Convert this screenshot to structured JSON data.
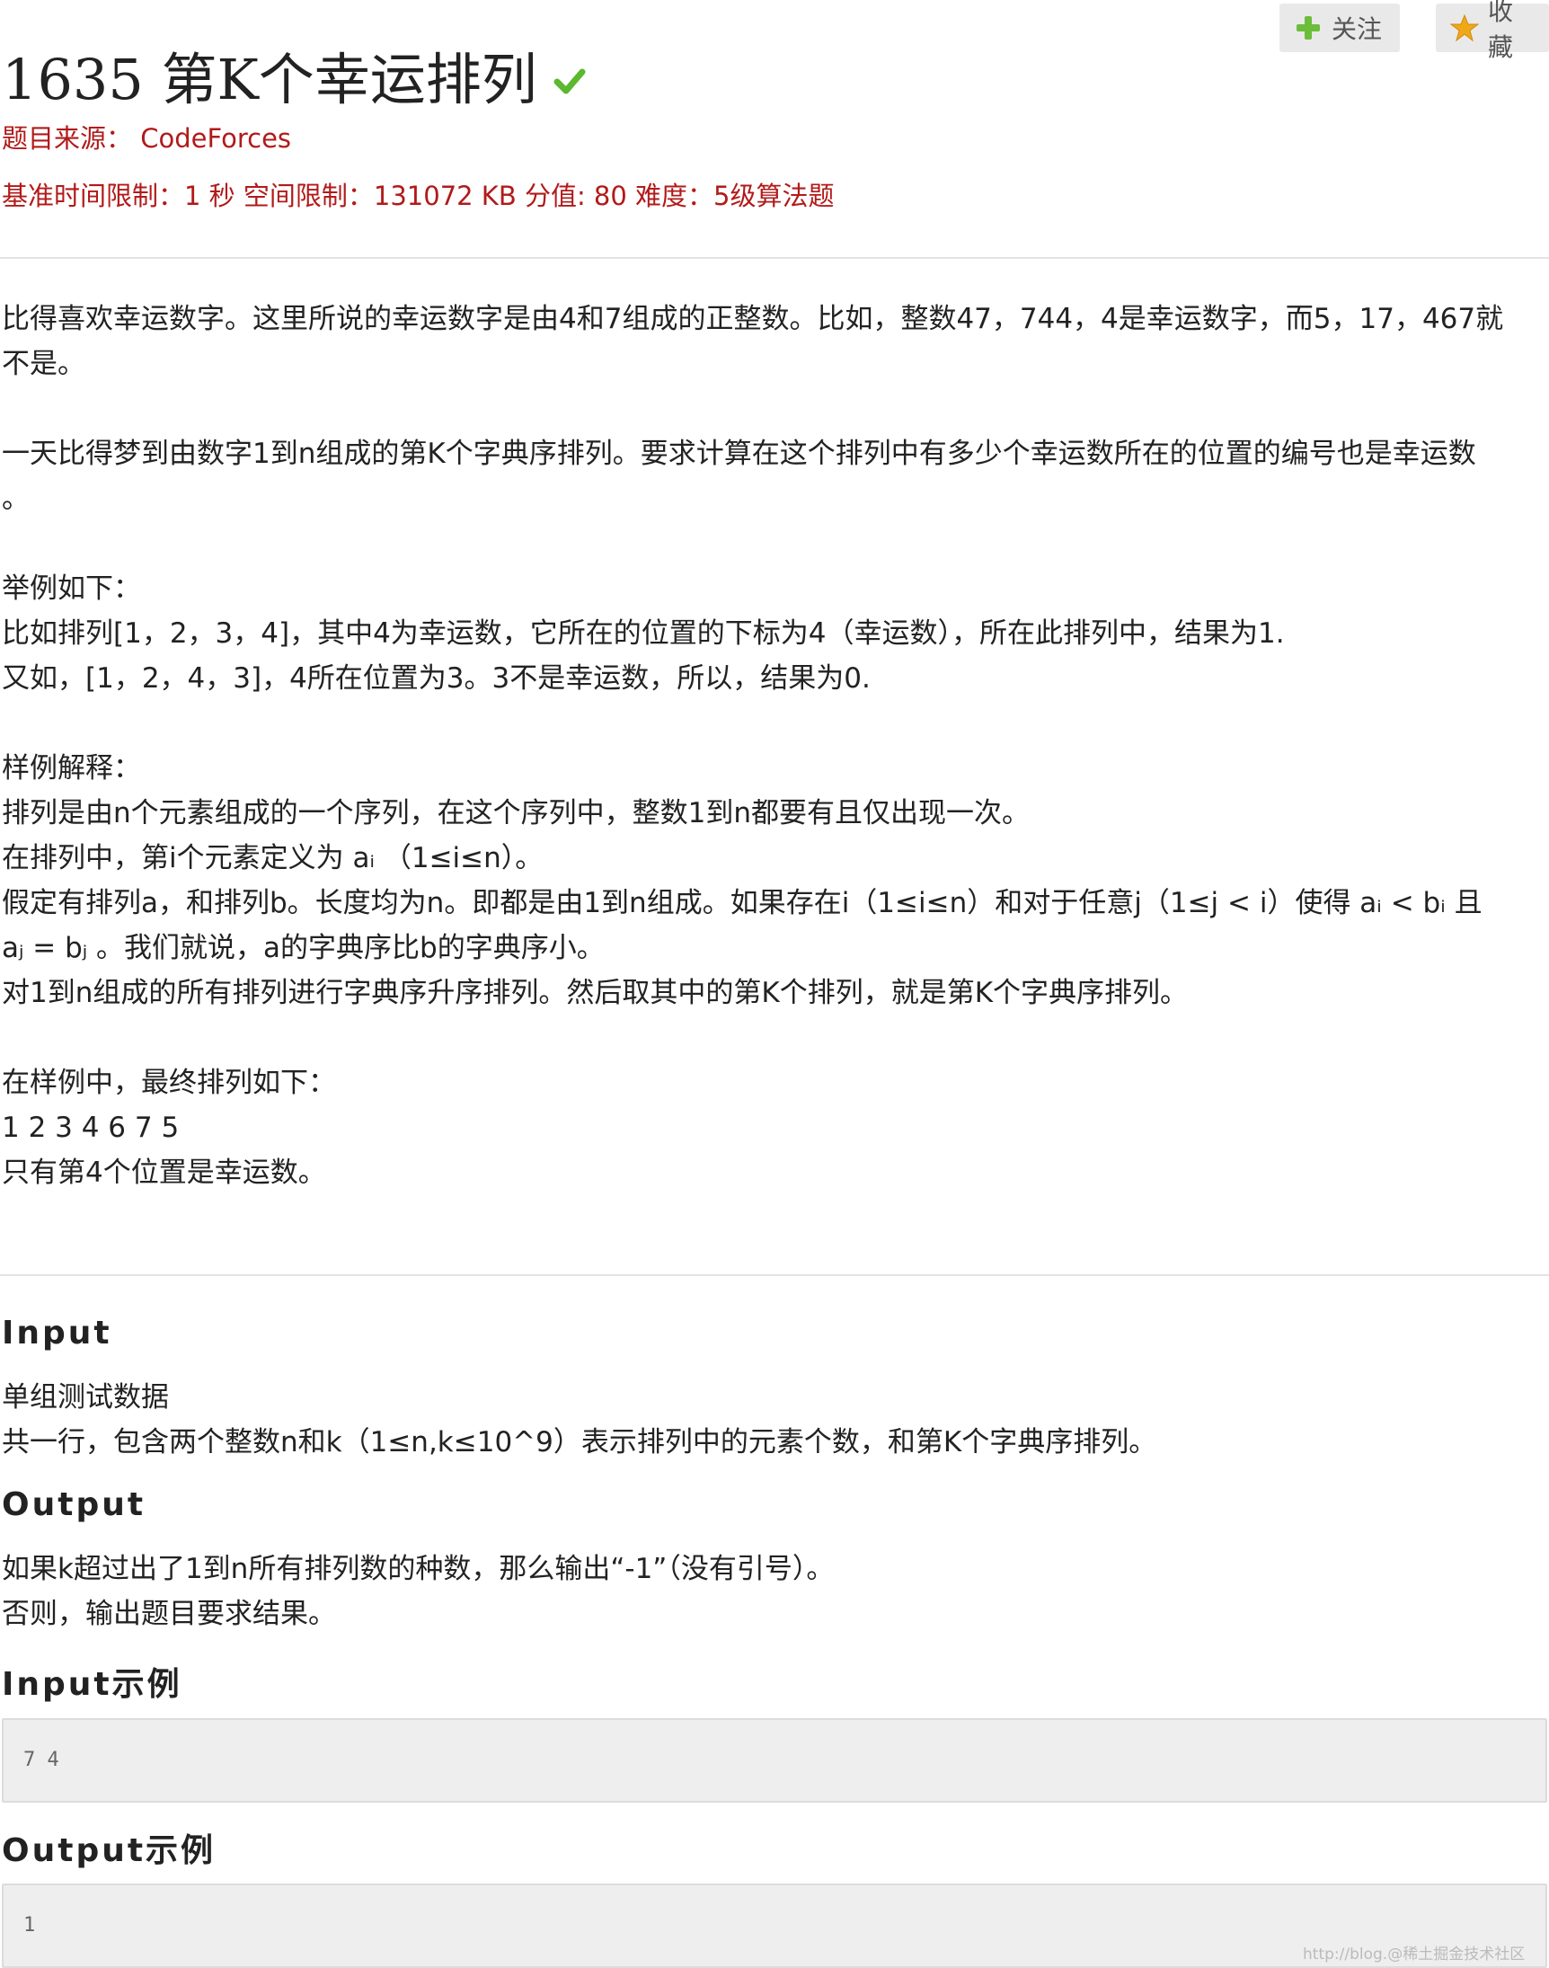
{
  "header": {
    "title": "1635 第K个幸运排列",
    "follow_label": "关注",
    "favorite_label": "收藏",
    "source_label": "题目来源： CodeForces",
    "limits_label": "基准时间限制：1 秒 空间限制：131072 KB 分值: 80 难度：5级算法题"
  },
  "description": {
    "lines": [
      "比得喜欢幸运数字。这里所说的幸运数字是由4和7组成的正整数。比如，整数47，744，4是幸运数字，而5，17，467就",
      "不是。",
      "",
      "一天比得梦到由数字1到n组成的第K个字典序排列。要求计算在这个排列中有多少个幸运数所在的位置的编号也是幸运数",
      "。",
      "",
      "举例如下：",
      "比如排列[1，2，3，4]，其中4为幸运数，它所在的位置的下标为4（幸运数），所在此排列中，结果为1.",
      "又如，[1，2，4，3]，4所在位置为3。3不是幸运数，所以，结果为0.",
      "",
      "样例解释：",
      "排列是由n个元素组成的一个序列，在这个序列中，整数1到n都要有且仅出现一次。",
      "在排列中，第i个元素定义为 aᵢ （1≤i≤n）。",
      "假定有排列a，和排列b。长度均为n。即都是由1到n组成。如果存在i（1≤i≤n）和对于任意j（1≤j < i）使得 aᵢ < bᵢ 且",
      "aⱼ = bⱼ 。我们就说，a的字典序比b的字典序小。",
      "对1到n组成的所有排列进行字典序升序排列。然后取其中的第K个排列，就是第K个字典序排列。",
      "",
      "在样例中，最终排列如下：",
      "1 2 3 4 6 7 5",
      "只有第4个位置是幸运数。"
    ]
  },
  "input_section": {
    "title": "Input",
    "lines": [
      "单组测试数据",
      "共一行，包含两个整数n和k（1≤n,k≤10^9）表示排列中的元素个数，和第K个字典序排列。"
    ]
  },
  "output_section": {
    "title": "Output",
    "lines": [
      "如果k超过出了1到n所有排列数的种数，那么输出“-1”（没有引号）。",
      "否则，输出题目要求结果。"
    ]
  },
  "sample_input": {
    "title": "Input示例",
    "value": "7 4"
  },
  "sample_output": {
    "title": "Output示例",
    "value": "1"
  },
  "watermark": "http://blog.@稀土掘金技术社区",
  "icons": {
    "solved": "check-icon",
    "follow": "plus-icon",
    "favorite": "star-icon"
  },
  "colors": {
    "meta_text": "#b21a1a",
    "check": "#5cb82e",
    "plus": "#6cbd3a",
    "star": "#f0a818"
  }
}
